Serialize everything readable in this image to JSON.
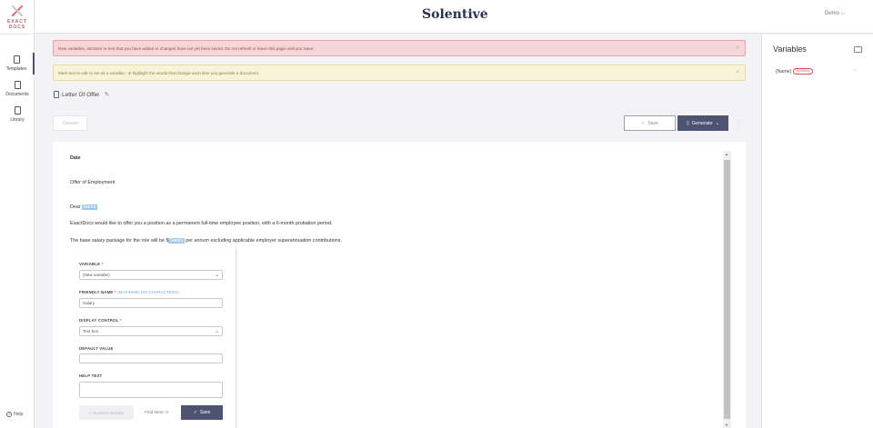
{
  "app": {
    "logo_line1": "EXACT",
    "logo_line2": "DOCS",
    "brand": "Solentive",
    "user": "Demo ⌵"
  },
  "nav": {
    "items": [
      {
        "label": "Templates",
        "icon": "template-icon",
        "active": true
      },
      {
        "label": "Documents",
        "icon": "documents-icon",
        "active": false
      },
      {
        "label": "Library",
        "icon": "library-icon",
        "active": false
      }
    ],
    "help": "Help"
  },
  "banners": {
    "error": "New variables, sections or text that you have added or changed have not yet been saved. Do not refresh or leave this page until you Save.",
    "info": "Mark text to edit or set as a variable - ie highlight the words that change each time you generate a document."
  },
  "document": {
    "title": "Letter Of Offer",
    "cancel": "Cancel",
    "save": "Save",
    "generate": "Generate",
    "lines": {
      "date": "Date",
      "heading": "Offer of Employment",
      "dear_prefix": "Dear ",
      "dear_var": "Name",
      "para1": "ExactDocs would like to offer you a position as a permanent full-time employee position, with a 6-month probation period.",
      "para2_prefix": "The base salary package for the role will be $",
      "para2_var": "Salary",
      "para2_suffix": " per annum excluding applicable employer superannuation contributions."
    }
  },
  "variable_form": {
    "variable_label": "VARIABLE",
    "variable_value": "(New variable)",
    "friendly_label": "FRIENDLY NAME",
    "friendly_hint": "(MAXIMUM 100 CHARACTERS)",
    "friendly_value": "Salary",
    "display_label": "DISPLAY CONTROL",
    "display_value": "Text box",
    "default_label": "DEFAULT VALUE",
    "default_value": "",
    "help_label": "HELP TEXT",
    "help_value": "",
    "unselect_btn": "Unselect variable",
    "find_next": "Find Next: 0",
    "save_btn": "Save",
    "required_mark": "*"
  },
  "variables_panel": {
    "title": "Variables",
    "items": [
      {
        "name": "{Name}",
        "badge": "MISSING"
      }
    ]
  },
  "colors": {
    "primary_button": "#4d5370",
    "error_bg": "#f5d5d8",
    "info_bg": "#f8f3d8",
    "highlight": "#9ec9ed",
    "accent": "#e06a6a"
  }
}
